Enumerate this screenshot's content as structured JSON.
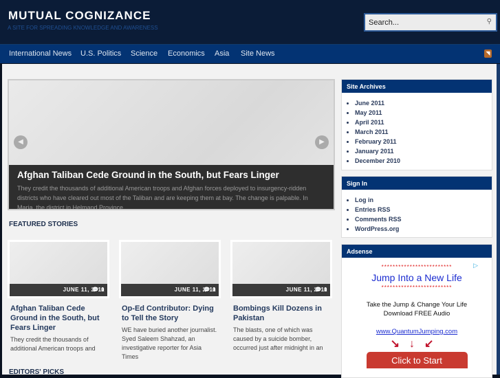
{
  "header": {
    "title": "MUTUAL COGNIZANCE",
    "tagline": "A SITE FOR SPREADING KNOWLEDGE AND AWARENESS",
    "search_placeholder": "Search..."
  },
  "nav": {
    "items": [
      "International News",
      "U.S. Politics",
      "Science",
      "Economics",
      "Asia",
      "Site News"
    ]
  },
  "slider": {
    "title": "Afghan Taliban Cede Ground in the South, but Fears Linger",
    "excerpt": "They credit the thousands of additional American troops and Afghan forces deployed to insurgency-ridden districts who have cleared out most of the Taliban and are keeping them at bay. The change is palpable. In Marja, the district in Helmand Province"
  },
  "featured": {
    "heading": "FEATURED STORIES",
    "cards": [
      {
        "date": "JUNE 11, 2011",
        "comments": "0",
        "title": "Afghan Taliban Cede Ground in the South, but Fears Linger",
        "excerpt": "They credit the thousands of additional American troops and"
      },
      {
        "date": "JUNE 11, 2011",
        "comments": "0",
        "title": "Op-Ed Contributor: Dying to Tell the Story",
        "excerpt": "WE have buried another journalist. Syed Saleem Shahzad, an investigative reporter for Asia Times"
      },
      {
        "date": "JUNE 11, 2011",
        "comments": "0",
        "title": "Bombings Kill Dozens in Pakistan",
        "excerpt": "The blasts, one of which was caused by a suicide bomber, occurred just after midnight in an"
      }
    ]
  },
  "editors": {
    "heading": "EDITORS' PICKS"
  },
  "sidebar": {
    "archives": {
      "title": "Site Archives",
      "items": [
        "June 2011",
        "May 2011",
        "April 2011",
        "March 2011",
        "February 2011",
        "January 2011",
        "December 2010"
      ]
    },
    "signin": {
      "title": "Sign In",
      "items": [
        "Log in",
        "Entries RSS",
        "Comments RSS",
        "WordPress.org"
      ]
    },
    "adsense": {
      "title": "Adsense",
      "stars": "*************************",
      "headline": "Jump Into a New Life",
      "line1": "Take the Jump & Change Your Life",
      "line2": "Download FREE Audio",
      "url": "www.QuantumJumping.com",
      "arrows": "↘↓↙",
      "button": "Click to Start"
    }
  }
}
